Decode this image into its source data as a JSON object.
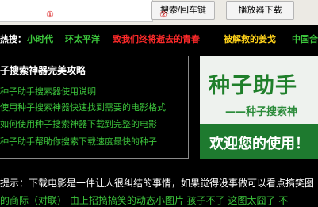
{
  "search": {
    "value": "",
    "marker": "①",
    "button_label": "搜索/回车键",
    "button_marker": "②"
  },
  "player_download_label": "播放器下载",
  "hot": {
    "label": "热搜：",
    "items": [
      "小时代",
      "环太平洋",
      "致我们终将逝去的青春",
      "被解救的姜戈",
      "中国合"
    ]
  },
  "guide": {
    "title": "子搜索神器完美攻略",
    "links": [
      "种子助手搜索器使用说明",
      "使用种子搜索神器快速找到需要的电影格式",
      "如何使用种子搜索神器下载到完整的电影",
      "种子助手帮助你搜索下载速度最快的种子"
    ]
  },
  "banner": {
    "title": "种子助手",
    "subtitle": "——种子搜索神",
    "welcome": "欢迎您的使用！"
  },
  "tip": "提示：下载电影是一件让人很纠结的事情，如果觉得没事做可以看点搞笑图",
  "cut_text": "的商际（对联）    由上招搞搞笑的动态小图片    孩子不了    这图太囧了    不",
  "colors": {
    "background": "#000000",
    "accent_green": "#3cc63c",
    "accent_red": "#ff2a2a",
    "accent_yellow": "#ffd21a",
    "banner_green": "#1e7a2f"
  }
}
